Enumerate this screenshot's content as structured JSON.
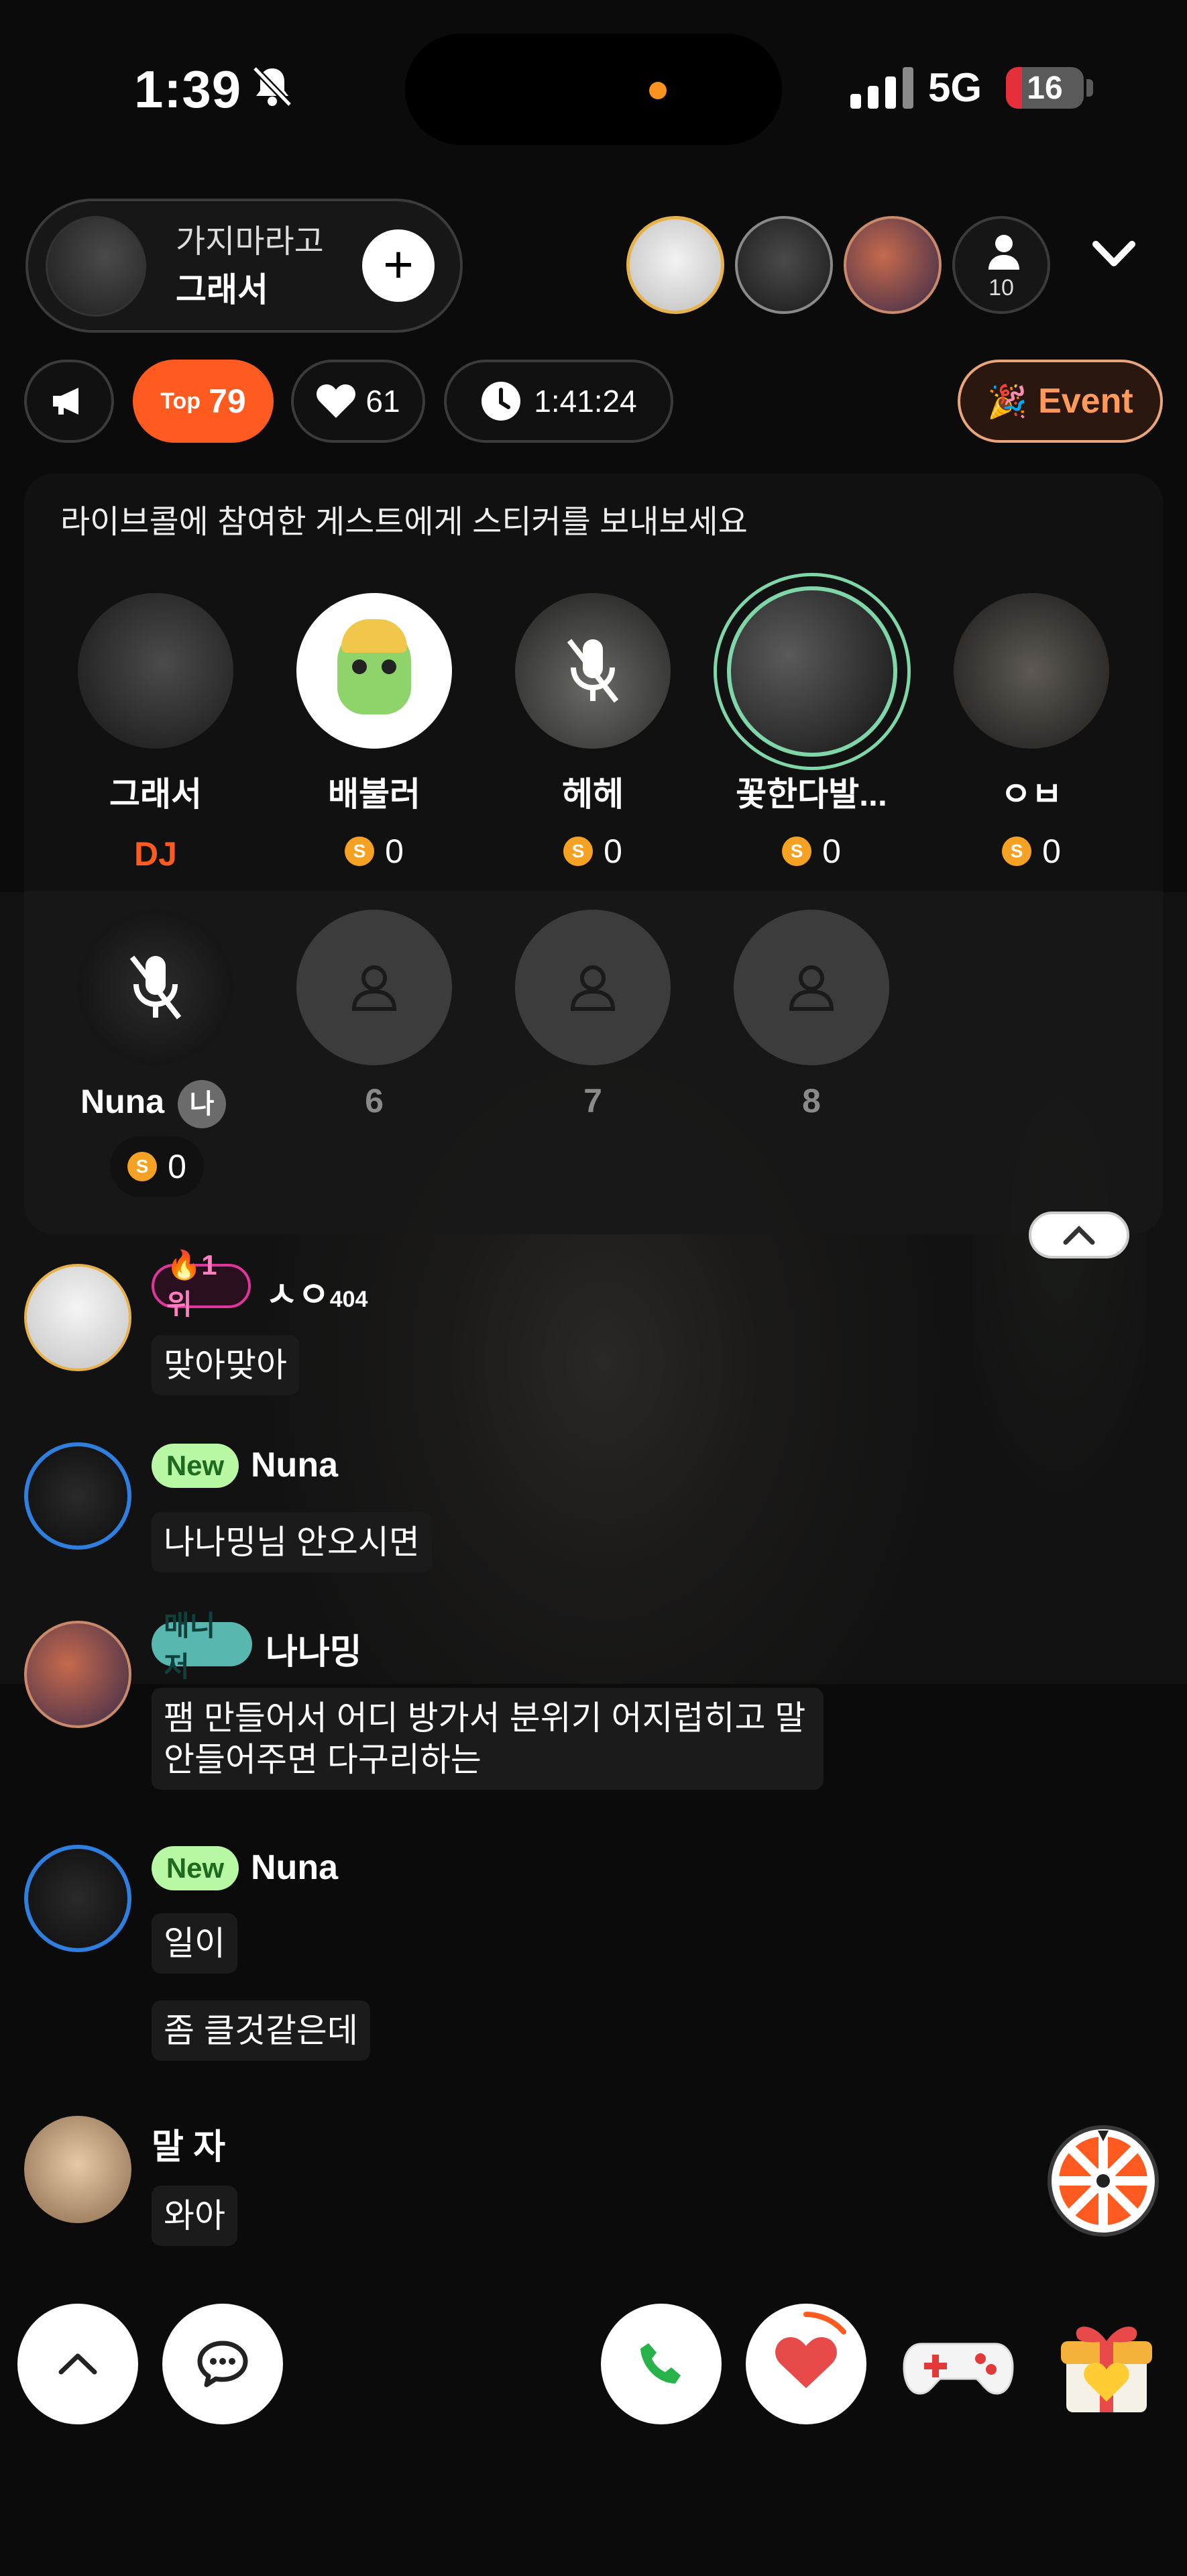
{
  "status_bar": {
    "time": "1:39",
    "network": "5G",
    "battery": "16",
    "icons": [
      "bell-muted-icon",
      "signal-icon"
    ]
  },
  "host": {
    "subtitle": "가지마라고",
    "name": "그래서",
    "follow_icon": "plus-icon"
  },
  "viewers": {
    "count": "10"
  },
  "stats": {
    "top_label": "Top",
    "top_rank": "79",
    "likes": "61",
    "duration": "1:41:24",
    "event_label": "Event"
  },
  "guest_panel": {
    "message": "라이브콜에 참여한 게스트에게 스티커를 보내보세요",
    "seats": [
      {
        "name": "그래서",
        "role": "DJ"
      },
      {
        "name": "배불러",
        "coins": "0"
      },
      {
        "name": "헤헤",
        "coins": "0",
        "muted": true
      },
      {
        "name": "꽃한다발...",
        "coins": "0",
        "speaking": true
      },
      {
        "name": "ㅇㅂ",
        "coins": "0"
      },
      {
        "name": "Nuna",
        "coins": "0",
        "muted": true,
        "me_badge": "나"
      },
      {
        "number": "6"
      },
      {
        "number": "7"
      },
      {
        "number": "8"
      }
    ],
    "coin_symbol": "S"
  },
  "chat": [
    {
      "badge": "🔥1위",
      "name": "ㅅㅇ",
      "suffix": "404",
      "messages": [
        "맞아맞아"
      ]
    },
    {
      "badge": "New",
      "name": "Nuna",
      "messages": [
        "나나밍님 안오시면"
      ]
    },
    {
      "badge": "매니저",
      "name": "나나밍",
      "messages": [
        "팸 만들어서 어디 방가서 분위기 어지럽히고 말\n안들어주면 다구리하는"
      ]
    },
    {
      "badge": "New",
      "name": "Nuna",
      "messages": [
        "일이",
        "좀 클것같은데"
      ]
    },
    {
      "name": "말 자",
      "messages": [
        "와아"
      ]
    }
  ],
  "bottom_bar": {
    "icons": [
      "chevron-up-icon",
      "chat-icon",
      "phone-icon",
      "heart-icon",
      "gamepad-icon",
      "gift-icon",
      "roulette-icon"
    ]
  },
  "colors": {
    "accent": "#ff5a1f",
    "coin": "#f4a124",
    "speaking_ring": "#7fd6a8",
    "new_badge": "#b8f7a4",
    "manager_badge": "#58b8b0",
    "rank_badge": "#e0359a"
  }
}
